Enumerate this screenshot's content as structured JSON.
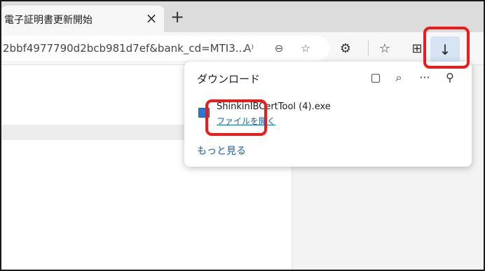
{
  "tab": {
    "title": "電子証明書更新開始",
    "close_glyph": "×",
    "new_tab_glyph": "+"
  },
  "address_bar": {
    "url": "2bbf4977790d2bcb981d7ef&bank_cd=MTI3...",
    "read_aloud_glyph": "A⁾",
    "zoom_glyph": "⊖",
    "favorite_add_glyph": "☆"
  },
  "toolbar": {
    "extensions_glyph": "⚙",
    "favorites_glyph": "☆",
    "collections_glyph": "⊞",
    "downloads_glyph": "↓"
  },
  "download_panel": {
    "title": "ダウンロード",
    "folder_glyph": "▢",
    "search_glyph": "⌕",
    "more_glyph": "···",
    "pin_glyph": "⚲",
    "file": {
      "name": "ShinkinIBCertTool (4).exe",
      "open_label": "ファイルを開く"
    },
    "see_more": "もっと見る"
  },
  "colors": {
    "accent_link": "#0a64c2",
    "annotation": "#ee1b1b",
    "downloads_active_bg": "#d6e4f3"
  }
}
